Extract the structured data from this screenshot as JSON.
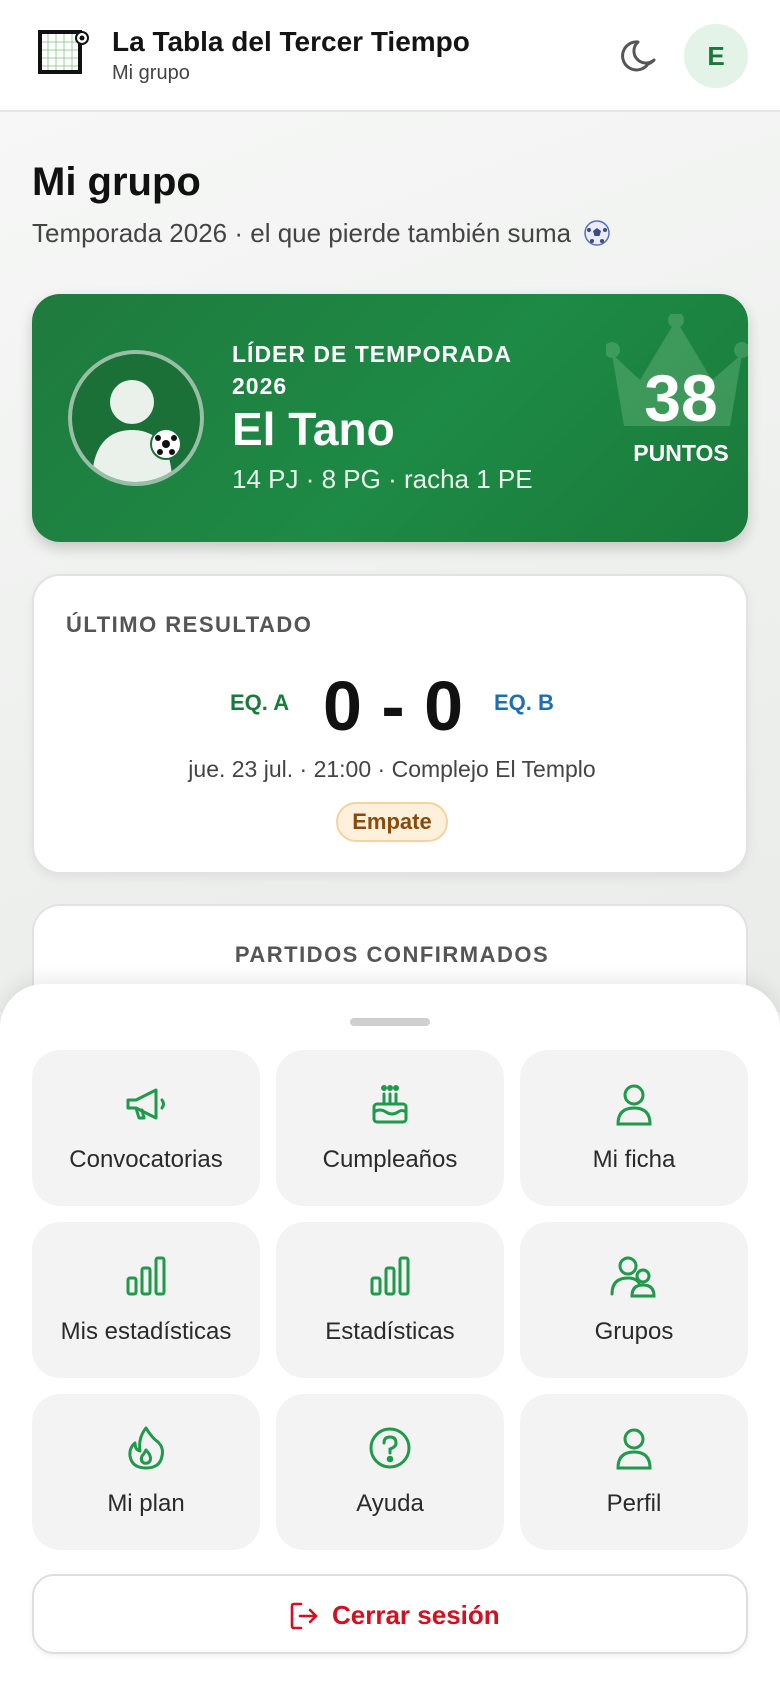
{
  "header": {
    "app_title": "La Tabla del Tercer Tiempo",
    "app_subtitle": "Mi grupo",
    "avatar_initial": "E",
    "icons": [
      "logo-icon",
      "moon-icon"
    ]
  },
  "page": {
    "title": "Mi grupo",
    "subtitle": "Temporada 2026 · el que pierde también suma"
  },
  "leader": {
    "label": "LÍDER DE TEMPORADA 2026",
    "name": "El Tano",
    "stats": "14 PJ · 8 PG · racha 1 PE",
    "points": "38",
    "points_label": "PUNTOS"
  },
  "last_result": {
    "title": "ÚLTIMO RESULTADO",
    "team_a": "EQ. A",
    "score": "0 - 0",
    "team_b": "EQ. B",
    "meta": "jue. 23 jul. · 21:00 · Complejo El Templo",
    "badge": "Empate"
  },
  "confirmed": {
    "title": "PARTIDOS CONFIRMADOS"
  },
  "menu": {
    "items": [
      {
        "label": "Convocatorias",
        "icon": "megaphone-icon"
      },
      {
        "label": "Cumpleaños",
        "icon": "cake-icon"
      },
      {
        "label": "Mi ficha",
        "icon": "user-icon"
      },
      {
        "label": "Mis estadísticas",
        "icon": "bar-chart-icon"
      },
      {
        "label": "Estadísticas",
        "icon": "bar-chart-icon"
      },
      {
        "label": "Grupos",
        "icon": "users-icon"
      },
      {
        "label": "Mi plan",
        "icon": "flame-icon"
      },
      {
        "label": "Ayuda",
        "icon": "help-circle-icon"
      },
      {
        "label": "Perfil",
        "icon": "user-icon"
      }
    ],
    "logout_label": "Cerrar sesión"
  },
  "colors": {
    "accent_green": "#1a7a3a",
    "icon_green": "#1f9a4a",
    "team_b_blue": "#1d6fb0",
    "logout_red": "#d40f1f",
    "badge_bg": "#fdf1dc"
  }
}
